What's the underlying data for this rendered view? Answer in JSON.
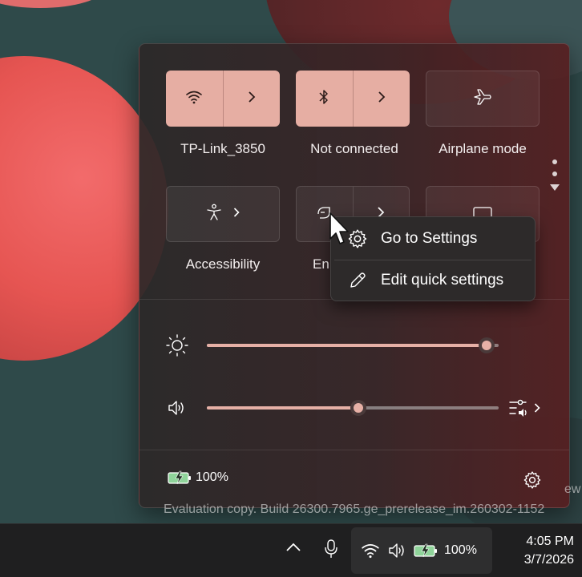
{
  "quick_settings": {
    "tiles": [
      {
        "label": "TP-Link_3850",
        "icon": "wifi-icon",
        "state": "on"
      },
      {
        "label": "Not connected",
        "icon": "bluetooth-icon",
        "state": "on"
      },
      {
        "label": "Airplane mode",
        "icon": "airplane-icon",
        "state": "off"
      },
      {
        "label": "Accessibility",
        "icon": "accessibility-icon",
        "state": "off"
      },
      {
        "label": "En",
        "icon": "energy-saver-icon",
        "state": "off"
      },
      {
        "label": "",
        "icon": "cast-icon",
        "state": "off"
      }
    ],
    "brightness": {
      "icon": "sun-icon",
      "value_percent": 96
    },
    "volume": {
      "icon": "speaker-icon",
      "value_percent": 52,
      "mixer_icon": "volume-mixer-icon"
    },
    "battery": {
      "icon": "battery-charging-icon",
      "percent_text": "100%"
    },
    "settings_icon": "gear-icon"
  },
  "context_menu": {
    "items": [
      {
        "label": "Go to Settings",
        "icon": "gear-icon"
      },
      {
        "label": "Edit quick settings",
        "icon": "pencil-icon"
      }
    ]
  },
  "watermark": {
    "text": "Evaluation copy. Build 26300.7965.ge_prerelease_im.260302-1152",
    "edge_text": "ew"
  },
  "taskbar": {
    "battery_text": "100%",
    "time": "4:05 PM",
    "date": "3/7/2026"
  },
  "colors": {
    "accent": "#e6aea3",
    "panel": "#2c2828",
    "taskbar": "#1f1f20"
  }
}
